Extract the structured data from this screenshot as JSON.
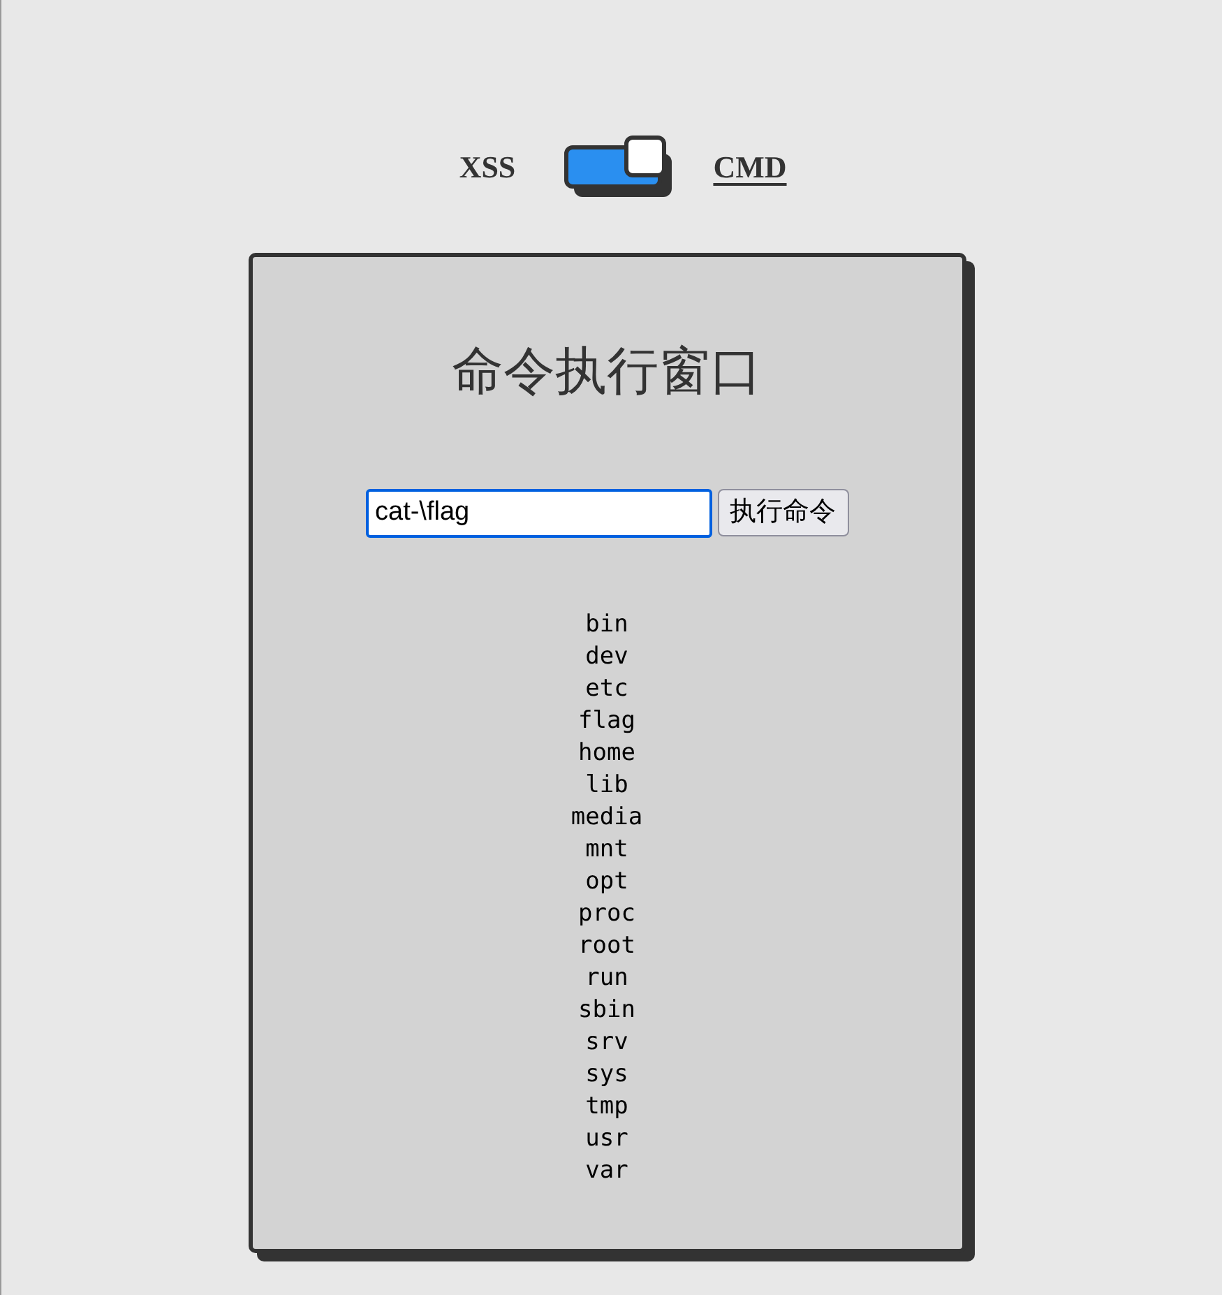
{
  "modes": [
    {
      "label": "XSS",
      "selected": false
    },
    {
      "label": "CMD",
      "selected": true
    }
  ],
  "toggle": {
    "on": true
  },
  "panel": {
    "title": "命令执行窗口",
    "command": {
      "value": "cat-\\flag"
    },
    "run_button": "执行命令",
    "output": [
      "bin",
      "dev",
      "etc",
      "flag",
      "home",
      "lib",
      "media",
      "mnt",
      "opt",
      "proc",
      "root",
      "run",
      "sbin",
      "srv",
      "sys",
      "tmp",
      "usr",
      "var"
    ]
  }
}
